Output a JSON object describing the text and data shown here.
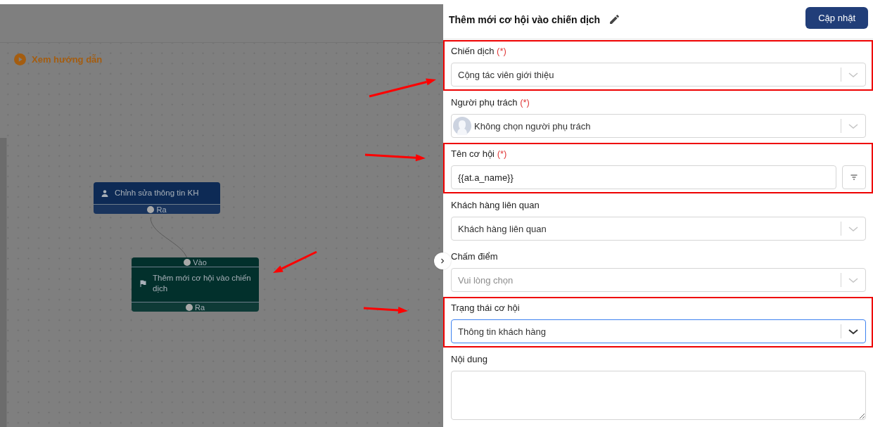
{
  "canvas": {
    "guide_link": "Xem hướng dẫn",
    "nodes": [
      {
        "kind": "contact",
        "title": "Chỉnh sửa thông tin KH",
        "color": "#0d2a55",
        "output_port": "Ra"
      },
      {
        "kind": "campaign",
        "title": "Thêm mới cơ hội vào chiến dịch",
        "color": "#02302c",
        "input_port": "Vào",
        "output_port": "Ra"
      }
    ]
  },
  "panel": {
    "title": "Thêm mới cơ hội vào chiến dịch",
    "submit_button": "Cập nhật",
    "fields": [
      {
        "kind": "select",
        "label": "Chiến dịch",
        "required_mark": "(*)",
        "value": "Cộng tác viên giới thiệu",
        "highlighted": true,
        "focused": false
      },
      {
        "kind": "avatar-select",
        "label": "Người phụ trách",
        "required_mark": "(*)",
        "value": "Không chọn người phụ trách",
        "highlighted": false,
        "focused": false
      },
      {
        "kind": "text-filter",
        "label": "Tên cơ hội",
        "required_mark": "(*)",
        "value": "{{at.a_name}}",
        "highlighted": true,
        "focused": false
      },
      {
        "kind": "select",
        "label": "Khách hàng liên quan",
        "value": "Khách hàng liên quan",
        "highlighted": false,
        "focused": false
      },
      {
        "kind": "select",
        "label": "Chấm điểm",
        "placeholder": "Vui lòng chọn",
        "highlighted": false,
        "focused": false
      },
      {
        "kind": "select",
        "label": "Trạng thái cơ hội",
        "value": "Thông tin khách hàng",
        "highlighted": true,
        "focused": true
      },
      {
        "kind": "textarea",
        "label": "Nội dung",
        "highlighted": false,
        "focused": false
      }
    ]
  }
}
